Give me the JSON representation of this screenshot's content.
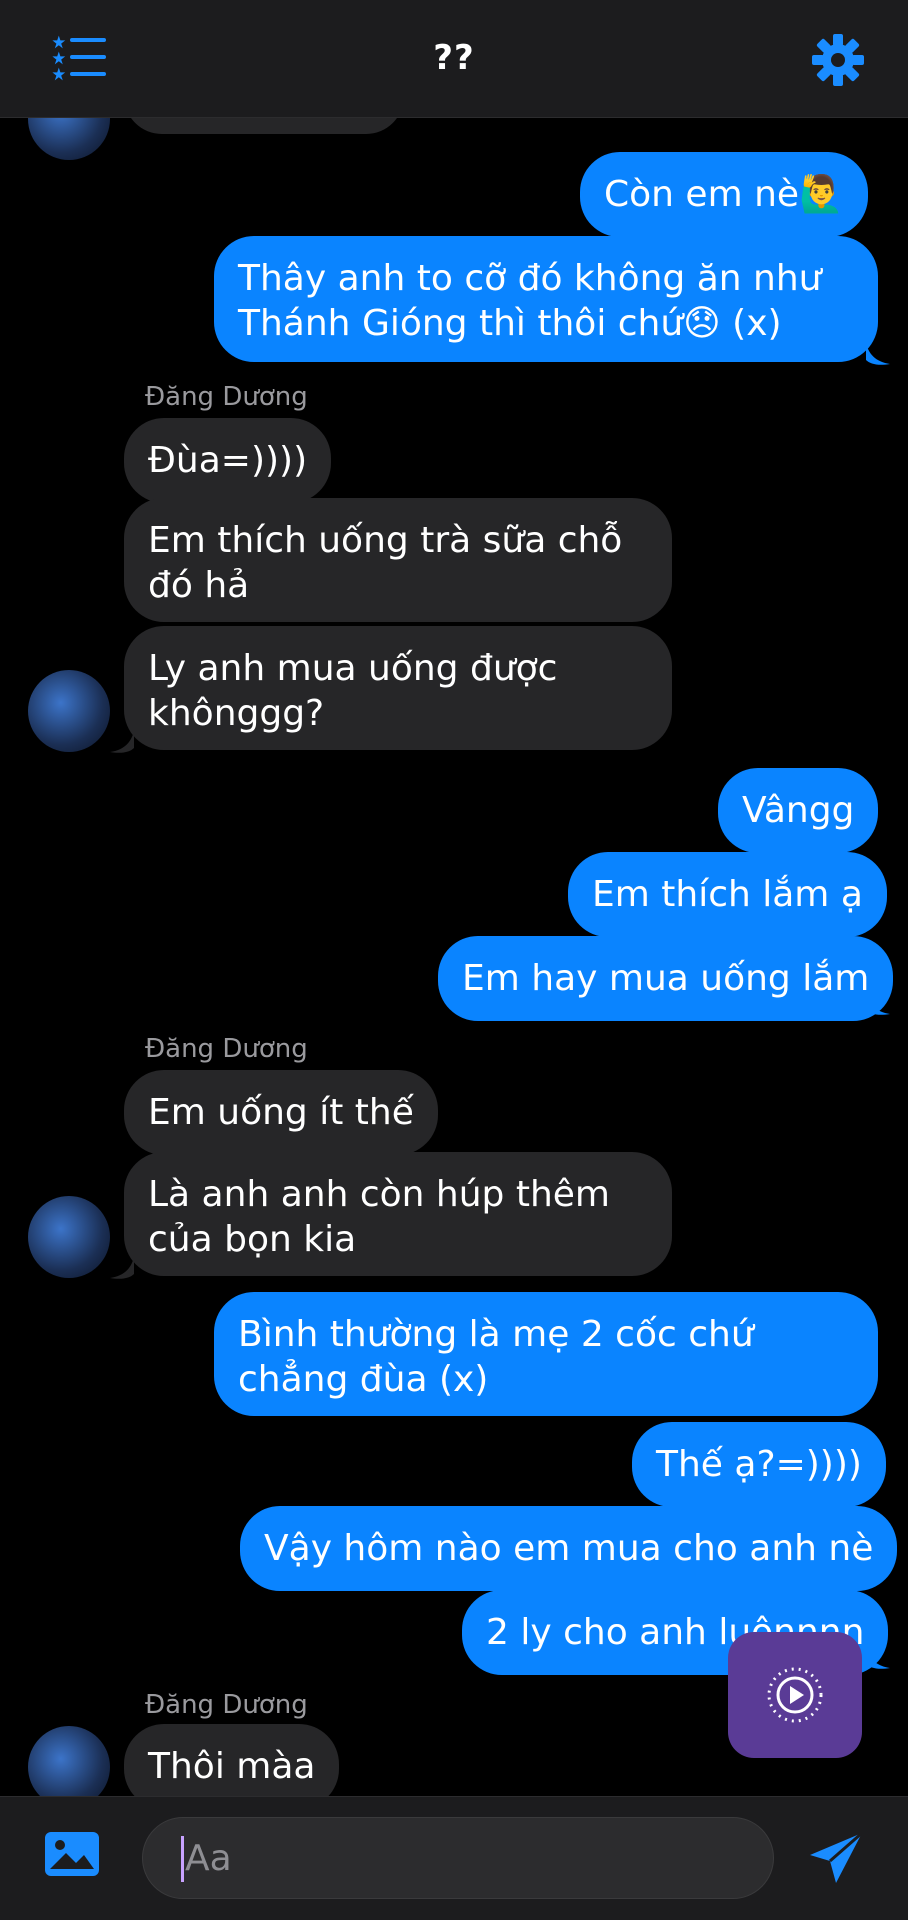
{
  "header": {
    "title": "??",
    "menu_icon": "list-star-icon",
    "settings_icon": "gear-icon"
  },
  "colors": {
    "accent": "#0a84ff",
    "incoming_bubble": "#262628",
    "floating_button": "#5a3b96"
  },
  "messages": [
    {
      "from": "me",
      "text": "Còn em nè🙋‍♂️"
    },
    {
      "from": "me",
      "lines": [
        "Thây anh to cỡ đó không ăn như",
        "Thánh Gióng thì thôi chứ😞 (x)"
      ]
    },
    {
      "sender": "Đăng Dương"
    },
    {
      "from": "them",
      "text": "Đùa=))))"
    },
    {
      "from": "them",
      "lines": [
        "Em thích uống trà sữa chỗ",
        "đó hả"
      ]
    },
    {
      "from": "them",
      "lines": [
        "Ly anh mua uống được",
        "khônggg?"
      ]
    },
    {
      "from": "me",
      "text": "Vângg"
    },
    {
      "from": "me",
      "text": "Em thích lắm ạ"
    },
    {
      "from": "me",
      "text": "Em hay mua uống lắm"
    },
    {
      "sender": "Đăng Dương"
    },
    {
      "from": "them",
      "text": "Em uống ít thế"
    },
    {
      "from": "them",
      "lines": [
        "Là anh anh còn húp thêm",
        "của bọn kia"
      ]
    },
    {
      "from": "me",
      "lines": [
        "Bình thường là mẹ 2 cốc chứ",
        "chẳng đùa (x)"
      ]
    },
    {
      "from": "me",
      "text": "Thế ạ?=))))"
    },
    {
      "from": "me",
      "text": "Vậy hôm nào em mua cho anh nè"
    },
    {
      "from": "me",
      "text": "2 ly cho anh luônnnn"
    },
    {
      "sender": "Đăng Dương"
    },
    {
      "from": "them",
      "text": "Thôi màa"
    }
  ],
  "composer": {
    "placeholder": "Aa",
    "image_icon": "image-icon",
    "send_icon": "send-icon"
  },
  "floating_button_icon": "play-circle-icon"
}
